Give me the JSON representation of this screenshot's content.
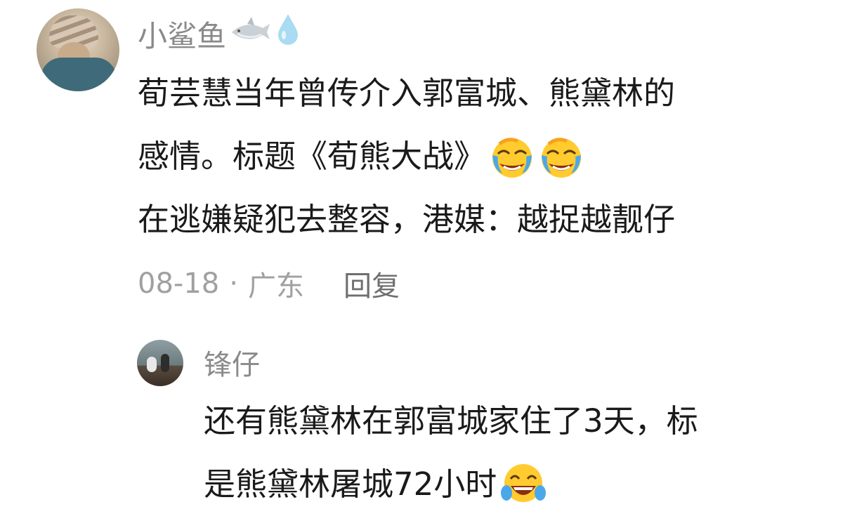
{
  "comment": {
    "username": "小鲨鱼",
    "username_icons": [
      "shark-icon",
      "water-drop-icon"
    ],
    "lines": [
      "荀芸慧当年曾传介入郭富城、熊黛林的",
      "感情。标题《荀熊大战》",
      "在逃嫌疑犯去整容，港媒：越捉越靓仔"
    ],
    "line2_emojis": [
      "laughing-crying-emoji",
      "laughing-crying-emoji"
    ],
    "date": "08-18",
    "separator": "·",
    "location": "广东",
    "reply_label": "回复"
  },
  "reply": {
    "username": "锋仔",
    "lines": [
      "还有熊黛林在郭富城家住了3天，标",
      "是熊黛林屠城72小时"
    ],
    "line2_emojis": [
      "tears-of-joy-emoji"
    ]
  }
}
